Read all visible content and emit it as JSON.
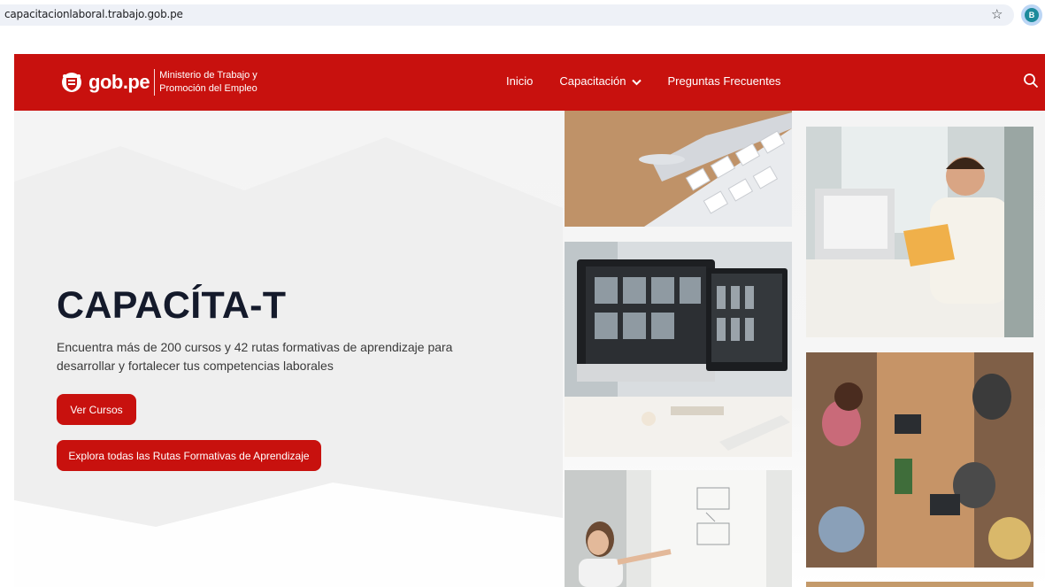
{
  "browser": {
    "url": "capacitacionlaboral.trabajo.gob.pe",
    "profile_initial": "B"
  },
  "header": {
    "logo_text": "gob.pe",
    "ministry_line1": "Ministerio de Trabajo y",
    "ministry_line2": "Promoción del Empleo",
    "nav": {
      "inicio": "Inicio",
      "capacitacion": "Capacitación",
      "preguntas": "Preguntas Frecuentes"
    }
  },
  "hero": {
    "title": "CAPACÍTA-T",
    "description": "Encuentra más de 200 cursos y 42 rutas formativas de aprendizaje para desarrollar y fortalecer tus competencias laborales",
    "btn_cursos": "Ver Cursos",
    "btn_rutas": "Explora todas las Rutas Formativas de Aprendizaje"
  },
  "colors": {
    "brand_red": "#c8110e",
    "title_navy": "#141a2b"
  },
  "icons": [
    "star-icon",
    "profile-icon",
    "gob-shield-icon",
    "chevron-down-icon",
    "search-icon"
  ]
}
